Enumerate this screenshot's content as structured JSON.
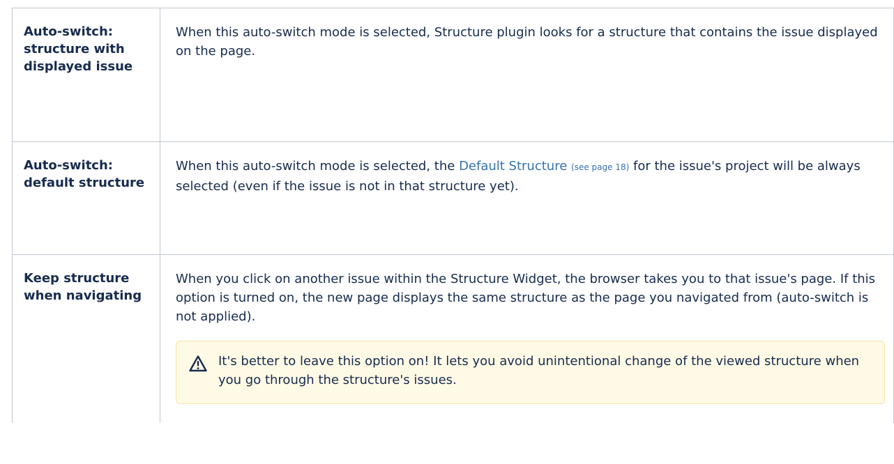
{
  "rows": [
    {
      "key": "Auto-switch: structure with displayed issue",
      "desc": "When this auto-switch mode is selected, Structure plugin looks for a structure that contains the issue displayed on the page."
    },
    {
      "key": "Auto-switch: default structure",
      "desc_before": "When this auto-switch mode is selected, the ",
      "link_text": "Default Structure",
      "page_ref": "(see page 18)",
      "desc_after": " for the issue's project will be always selected (even if the issue is not in that structure yet)."
    },
    {
      "key": "Keep structure when navigating",
      "desc": "When you click on another issue within the Structure Widget, the browser takes you to that issue's page. If this option is turned on, the new page displays the same structure as the page you navigated from (auto-switch is not applied).",
      "warning": {
        "icon": "warning-triangle-icon",
        "text": "It's better to leave this option on! It lets you avoid unintentional change of the viewed structure when you go through the structure's issues."
      }
    }
  ],
  "colors": {
    "text": "#172b4d",
    "link": "#3572b0",
    "border": "#c1c7d0",
    "warning_bg": "#fffae6",
    "warning_border": "#f5e2a8"
  }
}
